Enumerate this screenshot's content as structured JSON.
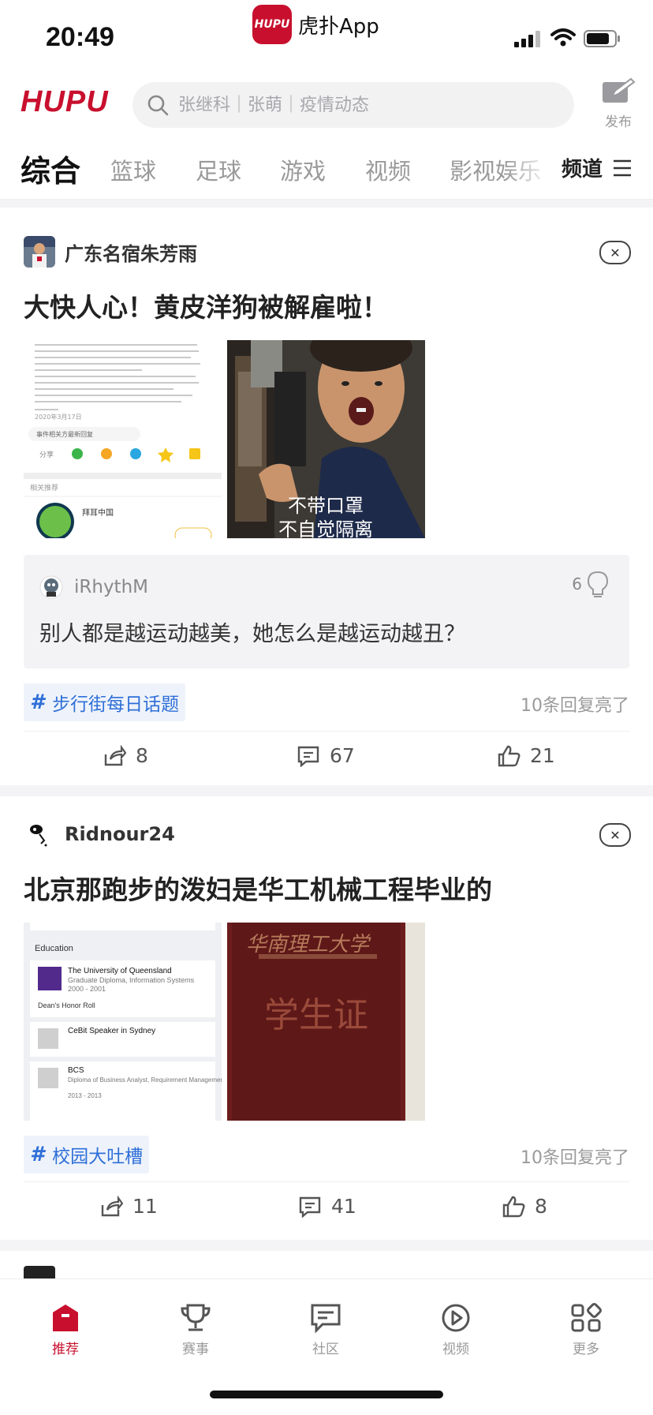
{
  "status_bar": {
    "time": "20:49",
    "app_badge_text": "HUPU",
    "app_name": "虎扑App"
  },
  "header": {
    "logo": "HUPU",
    "search_placeholder": "张继科｜张萌｜疫情动态",
    "publish_label": "发布"
  },
  "tabs": [
    {
      "label": "综合",
      "active": true
    },
    {
      "label": "篮球"
    },
    {
      "label": "足球"
    },
    {
      "label": "游戏"
    },
    {
      "label": "视频"
    },
    {
      "label": "影视娱乐"
    }
  ],
  "channel_label": "频道",
  "posts": [
    {
      "author": "广东名宿朱芳雨",
      "title": "大快人心！黄皮洋狗被解雇啦！",
      "image_caption": "不带口罩\n不自觉隔离",
      "screenshot_text": {
        "date": "2020年3月17日",
        "related_btn": "事件相关方最新回复",
        "share": "分享",
        "rec": "相关推荐",
        "bayer": "拜耳中国"
      },
      "comment": {
        "user": "iRhythM",
        "lights": "6",
        "text": "别人都是越运动越美，她怎么是越运动越丑？"
      },
      "topic": "步行街每日话题",
      "reply_hint": "10条回复亮了",
      "shares": "8",
      "comments": "67",
      "likes": "21"
    },
    {
      "author": "Ridnour24",
      "title": "北京那跑步的泼妇是华工机械工程毕业的",
      "profile_text": {
        "section": "Education",
        "uni": "The University of Queensland",
        "uni_sub": "Graduate Diploma, Information Systems",
        "uni_years": "2000 - 2001",
        "honor": "Dean's Honor Roll",
        "cebit": "CeBit Speaker in Sydney",
        "bcs": "BCS",
        "bcs_sub": "Diploma of Business Analyst, Requirement Management, BA Practice, Modelling Bu...",
        "bcs_years": "2013 - 2013"
      },
      "card_text": {
        "school": "华南理工大学",
        "cover": "学生证"
      },
      "topic": "校园大吐槽",
      "reply_hint": "10条回复亮了",
      "shares": "11",
      "comments": "41",
      "likes": "8"
    }
  ],
  "bottom_nav": [
    {
      "label": "推荐",
      "icon": "home-icon",
      "active": true
    },
    {
      "label": "赛事",
      "icon": "trophy-icon"
    },
    {
      "label": "社区",
      "icon": "chat-icon"
    },
    {
      "label": "视频",
      "icon": "play-icon"
    },
    {
      "label": "更多",
      "icon": "grid-icon"
    }
  ],
  "colors": {
    "brand": "#c8102e",
    "topic": "#2f6fd8"
  }
}
